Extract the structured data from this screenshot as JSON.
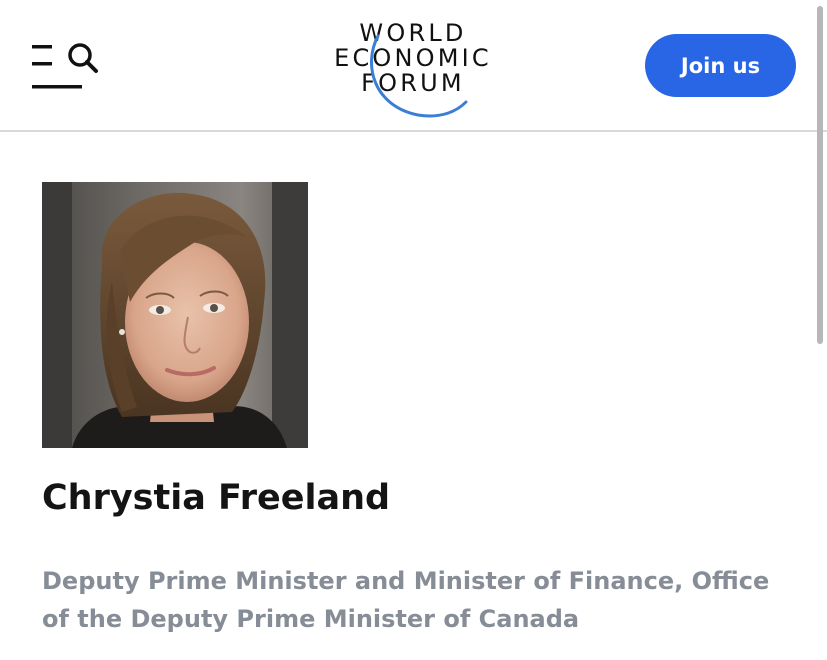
{
  "header": {
    "logo": {
      "lines": [
        "WORLD",
        "ECONOMIC",
        "FORUM"
      ],
      "arc_color": "#3a7fd5"
    },
    "menu_icon": "menu-icon",
    "search_icon": "search-icon",
    "join_label": "Join us",
    "join_color": "#2866e6"
  },
  "profile": {
    "name": "Chrystia Freeland",
    "title": "Deputy Prime Minister and Minister of Finance, Office of the Deputy Prime Minister of Canada",
    "photo": "portrait-photo"
  },
  "colors": {
    "divider": "#d9d9d9",
    "subtitle": "#868d96"
  }
}
